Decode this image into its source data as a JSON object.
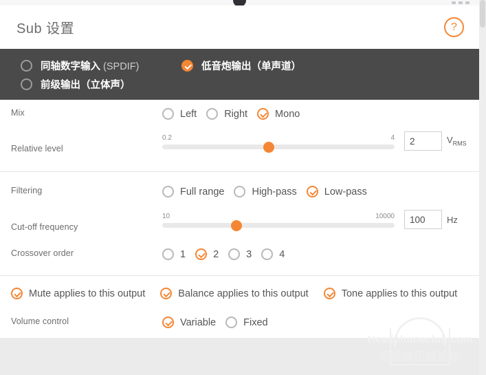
{
  "window": {
    "scrollbar_present": true,
    "accent_color": "#f58634",
    "band_color": "#4a4a4a",
    "page_bg": "#ebebeb"
  },
  "header": {
    "title": "Sub 设置",
    "help_label": "?"
  },
  "outputs": {
    "items": [
      {
        "label": "同轴数字输入",
        "suffix": " (SPDIF)",
        "checked": false
      },
      {
        "label": "低音炮输出（单声道）",
        "suffix": "",
        "checked": true
      },
      {
        "label": "前级输出（立体声）",
        "suffix": "",
        "checked": false
      }
    ]
  },
  "mix": {
    "label": "Mix",
    "options": [
      {
        "label": "Left",
        "checked": false
      },
      {
        "label": "Right",
        "checked": false
      },
      {
        "label": "Mono",
        "checked": true
      }
    ]
  },
  "relative_level": {
    "label": "Relative level",
    "min_label": "0.2",
    "max_label": "4",
    "value": "2",
    "unit": "V",
    "unit_sub": "RMS",
    "thumb_percent": 46
  },
  "filtering": {
    "label": "Filtering",
    "options": [
      {
        "label": "Full range",
        "checked": false
      },
      {
        "label": "High-pass",
        "checked": false
      },
      {
        "label": "Low-pass",
        "checked": true
      }
    ]
  },
  "cutoff": {
    "label": "Cut-off frequency",
    "min_label": "10",
    "max_label": "10000",
    "value": "100",
    "unit": "Hz",
    "thumb_percent": 32
  },
  "crossover": {
    "label": "Crossover order",
    "options": [
      {
        "label": "1",
        "checked": false
      },
      {
        "label": "2",
        "checked": true
      },
      {
        "label": "3",
        "checked": false
      },
      {
        "label": "4",
        "checked": false
      }
    ]
  },
  "applies": {
    "items": [
      {
        "label": "Mute applies to this output",
        "checked": true
      },
      {
        "label": "Balance applies to this output",
        "checked": true
      },
      {
        "label": "Tone applies to this output",
        "checked": true
      }
    ]
  },
  "volume_control": {
    "label": "Volume control",
    "options": [
      {
        "label": "Variable",
        "checked": true
      },
      {
        "label": "Fixed",
        "checked": false
      }
    ]
  },
  "watermark": {
    "line1": "Headphoneclub.com",
    "line2": "耳机俱乐部论坛"
  }
}
